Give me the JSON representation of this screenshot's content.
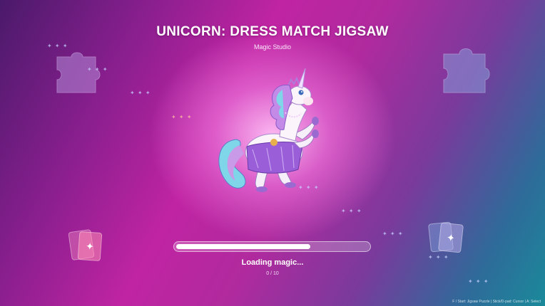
{
  "game": {
    "title": "UNICORN: DRESS MATCH JIGSAW",
    "studio": "Magic Studio"
  },
  "loading": {
    "text": "Loading magic...",
    "counter": "0 / 10",
    "progress_fraction": 0.7
  },
  "footer": {
    "controls_hint": "F / Start: Jigsaw Puzzle | Stick/D-pad: Cursor | A: Select"
  },
  "colors": {
    "background_left": "#4a1a6b",
    "background_center": "#c024a2",
    "background_right": "#1a8a9a",
    "progress_fill": "#ffffff"
  },
  "icons": [
    "puzzle-piece-icon",
    "sparkle-icon",
    "card-icon",
    "unicorn-mascot"
  ]
}
